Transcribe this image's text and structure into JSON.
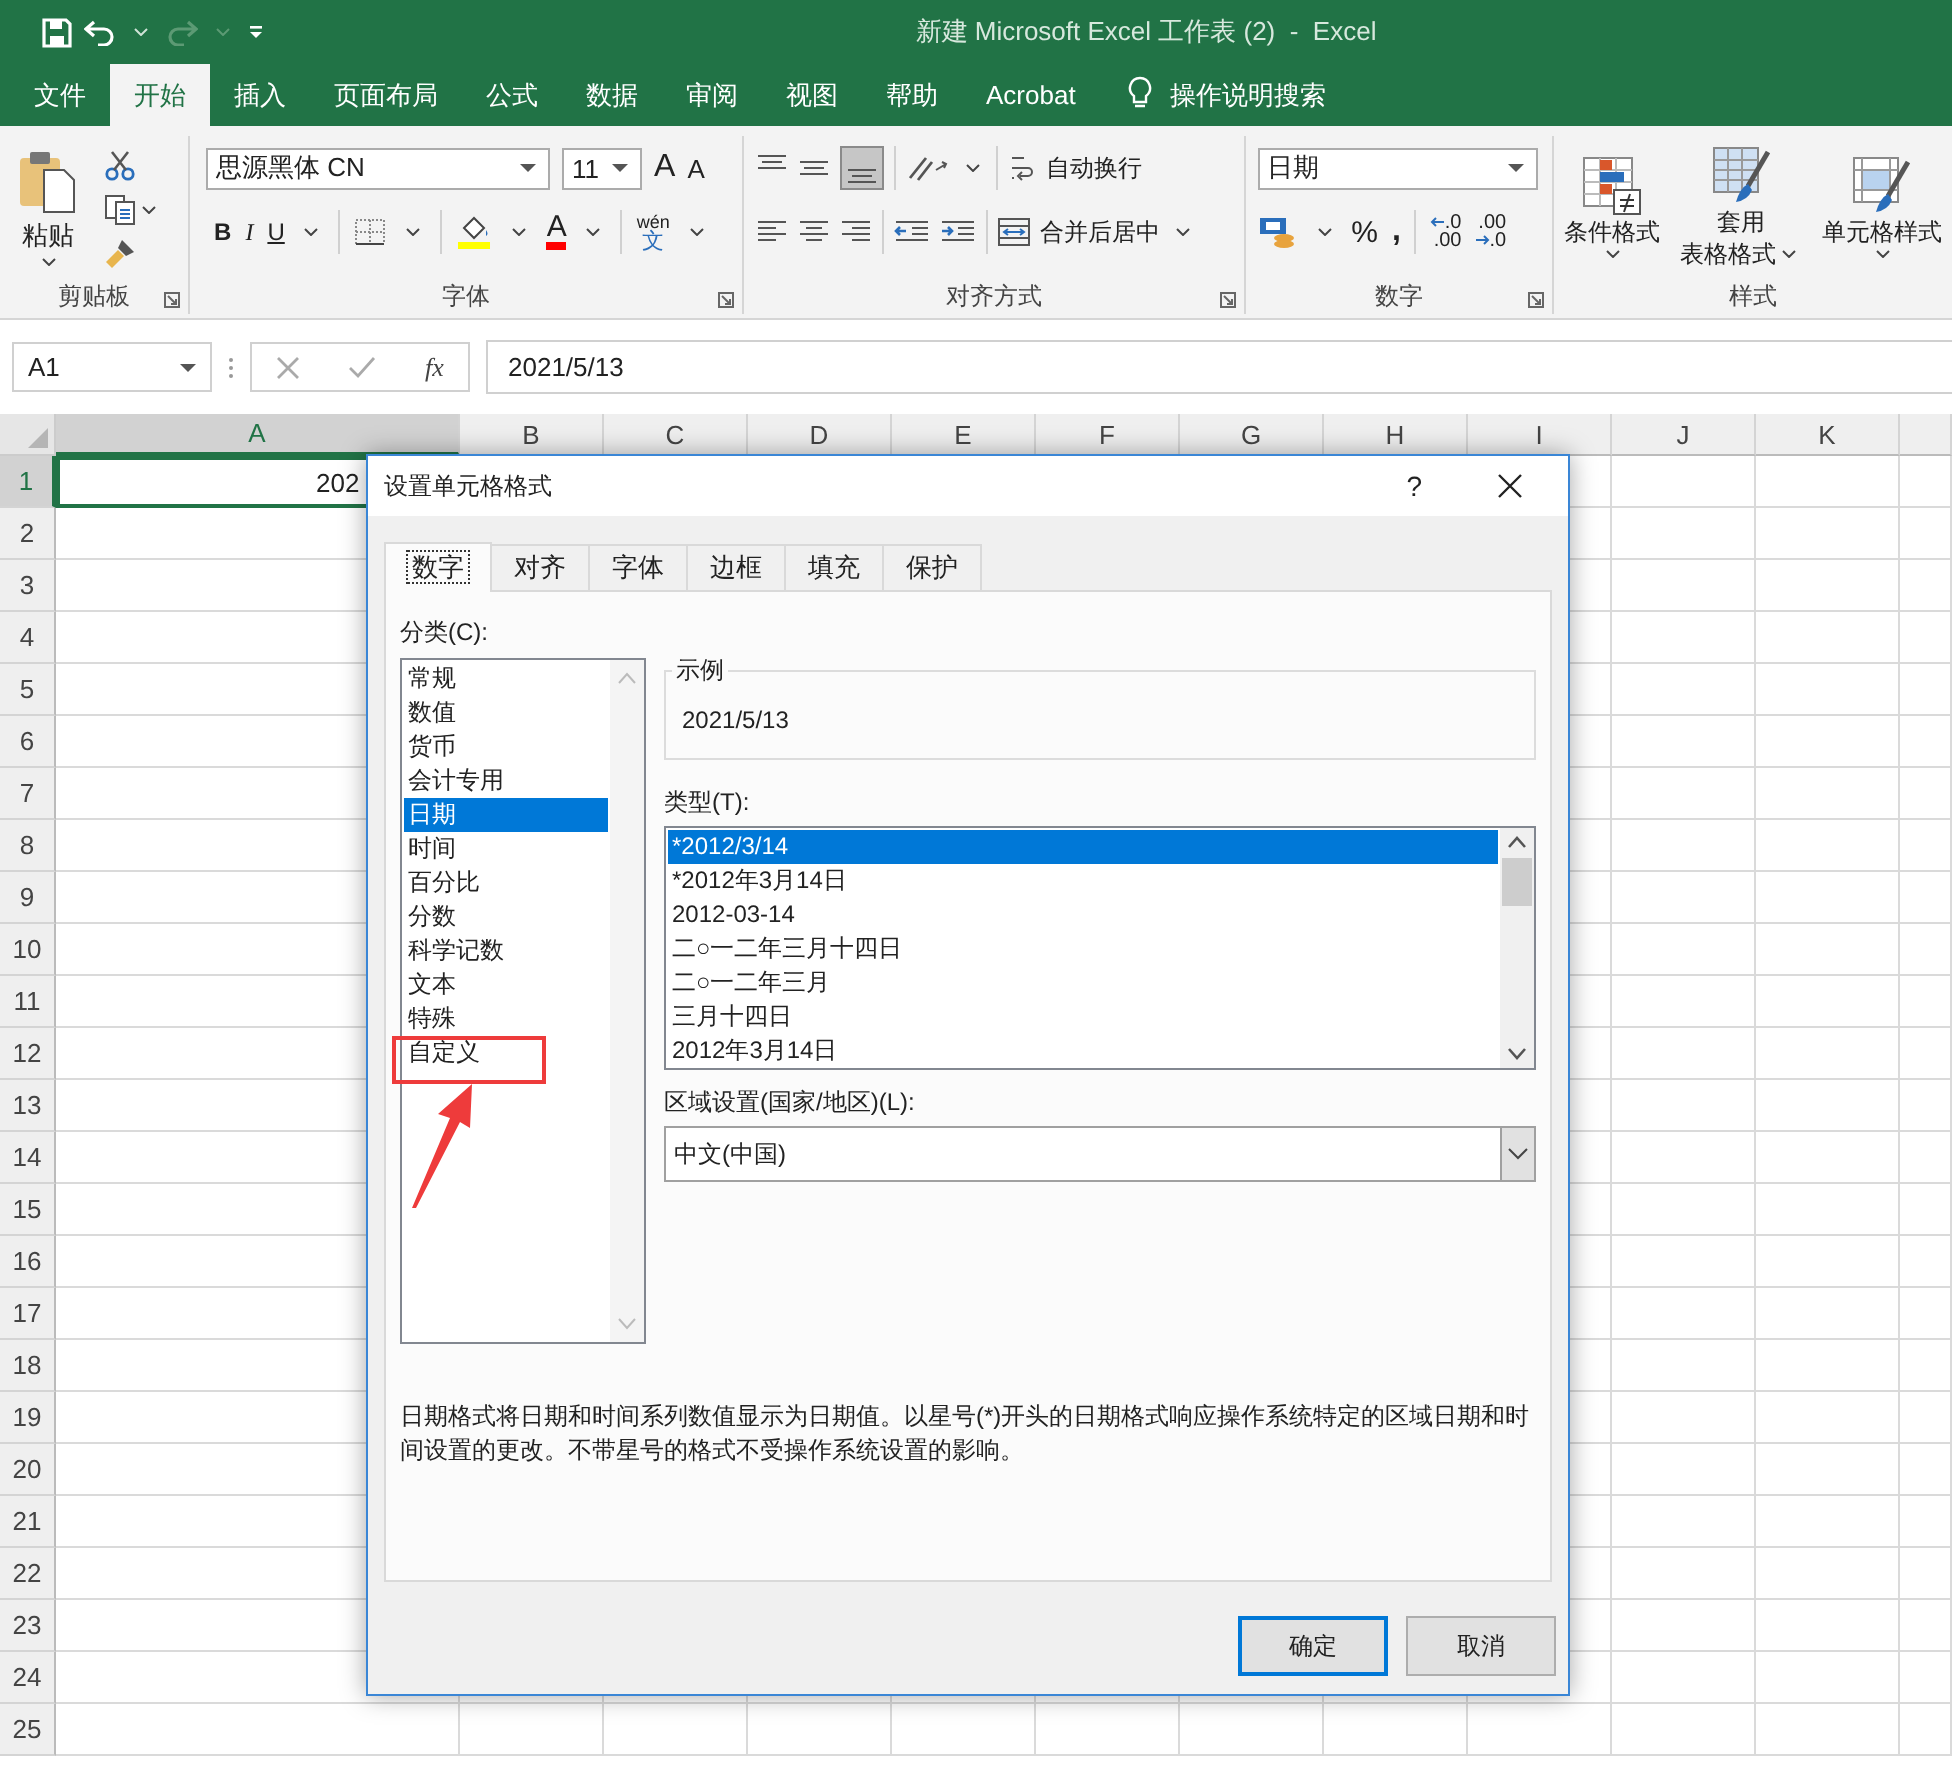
{
  "window": {
    "title": "新建 Microsoft Excel 工作表 (2)  -  Excel"
  },
  "ribbon_tabs": [
    {
      "label": "文件",
      "selected": false
    },
    {
      "label": "开始",
      "selected": true
    },
    {
      "label": "插入",
      "selected": false
    },
    {
      "label": "页面布局",
      "selected": false
    },
    {
      "label": "公式",
      "selected": false
    },
    {
      "label": "数据",
      "selected": false
    },
    {
      "label": "审阅",
      "selected": false
    },
    {
      "label": "视图",
      "selected": false
    },
    {
      "label": "帮助",
      "selected": false
    },
    {
      "label": "Acrobat",
      "selected": false
    }
  ],
  "tell_me": "操作说明搜索",
  "ribbon": {
    "paste": "粘贴",
    "font_name": "思源黑体 CN",
    "font_size": "11",
    "grow_font": "A",
    "shrink_font": "A",
    "bold": "B",
    "italic": "I",
    "underline": "U",
    "font_color": "A",
    "phonetic_top": "wén",
    "phonetic_bottom": "文",
    "wrap_text": "自动换行",
    "merge_center": "合并后居中",
    "number_format": "日期",
    "percent": "%",
    "comma": ",",
    "increase_decimal": [
      ".0",
      ".00"
    ],
    "decrease_decimal": [
      ".00",
      ".0"
    ],
    "styles": [
      {
        "lines": [
          "条件格式"
        ]
      },
      {
        "lines": [
          "套用",
          "表格格式"
        ]
      },
      {
        "lines": [
          "单元格样式"
        ]
      }
    ],
    "groups": [
      "剪贴板",
      "字体",
      "对齐方式",
      "数字",
      "样式"
    ]
  },
  "formula_bar": {
    "name_box": "A1",
    "fx": "fx",
    "value": "2021/5/13"
  },
  "grid": {
    "columns": [
      {
        "label": "A",
        "selected": true
      },
      {
        "label": "B",
        "selected": false
      },
      {
        "label": "C",
        "selected": false
      },
      {
        "label": "D",
        "selected": false
      },
      {
        "label": "E",
        "selected": false
      },
      {
        "label": "F",
        "selected": false
      },
      {
        "label": "G",
        "selected": false
      },
      {
        "label": "H",
        "selected": false
      },
      {
        "label": "I",
        "selected": false
      },
      {
        "label": "J",
        "selected": false
      },
      {
        "label": "K",
        "selected": false
      }
    ],
    "rows": [
      {
        "label": "1",
        "selected": true,
        "a": "202"
      },
      {
        "label": "2",
        "selected": false
      },
      {
        "label": "3",
        "selected": false
      },
      {
        "label": "4",
        "selected": false
      },
      {
        "label": "5",
        "selected": false
      },
      {
        "label": "6",
        "selected": false
      },
      {
        "label": "7",
        "selected": false
      },
      {
        "label": "8",
        "selected": false
      },
      {
        "label": "9",
        "selected": false
      },
      {
        "label": "10",
        "selected": false
      },
      {
        "label": "11",
        "selected": false
      },
      {
        "label": "12",
        "selected": false
      },
      {
        "label": "13",
        "selected": false
      },
      {
        "label": "14",
        "selected": false
      },
      {
        "label": "15",
        "selected": false
      },
      {
        "label": "16",
        "selected": false
      },
      {
        "label": "17",
        "selected": false
      },
      {
        "label": "18",
        "selected": false
      },
      {
        "label": "19",
        "selected": false
      },
      {
        "label": "20",
        "selected": false
      },
      {
        "label": "21",
        "selected": false
      },
      {
        "label": "22",
        "selected": false
      },
      {
        "label": "23",
        "selected": false
      },
      {
        "label": "24",
        "selected": false
      },
      {
        "label": "25",
        "selected": false
      }
    ]
  },
  "dialog": {
    "title": "设置单元格格式",
    "help": "?",
    "tabs": [
      {
        "label": "数字",
        "selected": true
      },
      {
        "label": "对齐",
        "selected": false
      },
      {
        "label": "字体",
        "selected": false
      },
      {
        "label": "边框",
        "selected": false
      },
      {
        "label": "填充",
        "selected": false
      },
      {
        "label": "保护",
        "selected": false
      }
    ],
    "category_label": "分类(C):",
    "categories": [
      {
        "label": "常规",
        "selected": false
      },
      {
        "label": "数值",
        "selected": false
      },
      {
        "label": "货币",
        "selected": false
      },
      {
        "label": "会计专用",
        "selected": false
      },
      {
        "label": "日期",
        "selected": true
      },
      {
        "label": "时间",
        "selected": false
      },
      {
        "label": "百分比",
        "selected": false
      },
      {
        "label": "分数",
        "selected": false
      },
      {
        "label": "科学记数",
        "selected": false
      },
      {
        "label": "文本",
        "selected": false
      },
      {
        "label": "特殊",
        "selected": false
      },
      {
        "label": "自定义",
        "selected": false
      }
    ],
    "sample_label": "示例",
    "sample_value": "2021/5/13",
    "type_label": "类型(T):",
    "types": [
      {
        "label": "*2012/3/14",
        "selected": true
      },
      {
        "label": "*2012年3月14日",
        "selected": false
      },
      {
        "label": "2012-03-14",
        "selected": false
      },
      {
        "label": "二○一二年三月十四日",
        "selected": false
      },
      {
        "label": "二○一二年三月",
        "selected": false
      },
      {
        "label": "三月十四日",
        "selected": false
      },
      {
        "label": "2012年3月14日",
        "selected": false
      }
    ],
    "locale_label": "区域设置(国家/地区)(L):",
    "locale_value": "中文(中国)",
    "description": "日期格式将日期和时间系列数值显示为日期值。以星号(*)开头的日期格式响应操作系统特定的区域日期和时间设置的更改。不带星号的格式不受操作系统设置的影响。",
    "buttons": [
      {
        "label": "确定",
        "default": true
      },
      {
        "label": "取消",
        "default": false
      }
    ]
  }
}
